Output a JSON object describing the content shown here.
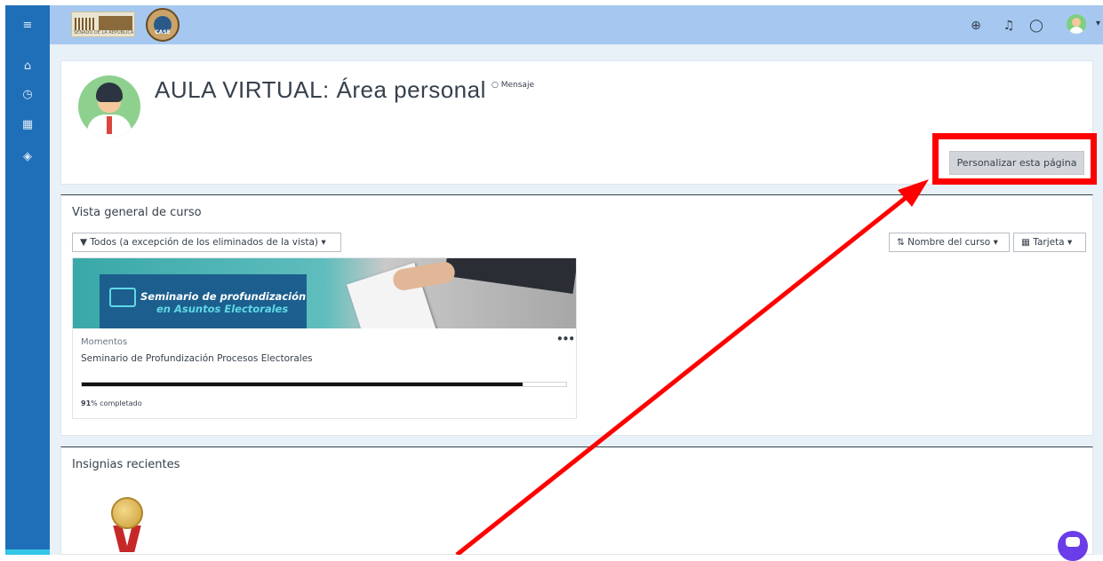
{
  "header": {
    "page_title": "AULA VIRTUAL: Área personal",
    "message_link": "Mensaje",
    "customize_button": "Personalizar esta página",
    "logo_text": "SENADO DE LA REPÚBLICA",
    "seal_text": "CASE"
  },
  "course_overview": {
    "title": "Vista general de curso",
    "filter_label": "Todos (a excepción de los eliminados de la vista)",
    "sort_label": "Nombre del curso",
    "view_label": "Tarjeta",
    "courses": [
      {
        "category": "Momentos",
        "name": "Seminario de Profundización Procesos Electorales",
        "banner_line1": "Seminario de profundización",
        "banner_line2": "en Asuntos Electorales",
        "progress_percent": 91,
        "progress_value": "91",
        "progress_suffix": "% completado"
      }
    ]
  },
  "badges": {
    "title": "Insignias recientes"
  },
  "colors": {
    "sidebar": "#1f6fb8",
    "topbar": "#a6c8f0",
    "highlight": "#ff0000",
    "chat": "#6a3de8"
  },
  "icons": {
    "sidebar": [
      "menu-icon",
      "home-icon",
      "dashboard-icon",
      "calendar-icon",
      "courses-icon"
    ],
    "topbar": [
      "language-icon",
      "notification-icon",
      "messages-icon",
      "user-avatar"
    ]
  }
}
